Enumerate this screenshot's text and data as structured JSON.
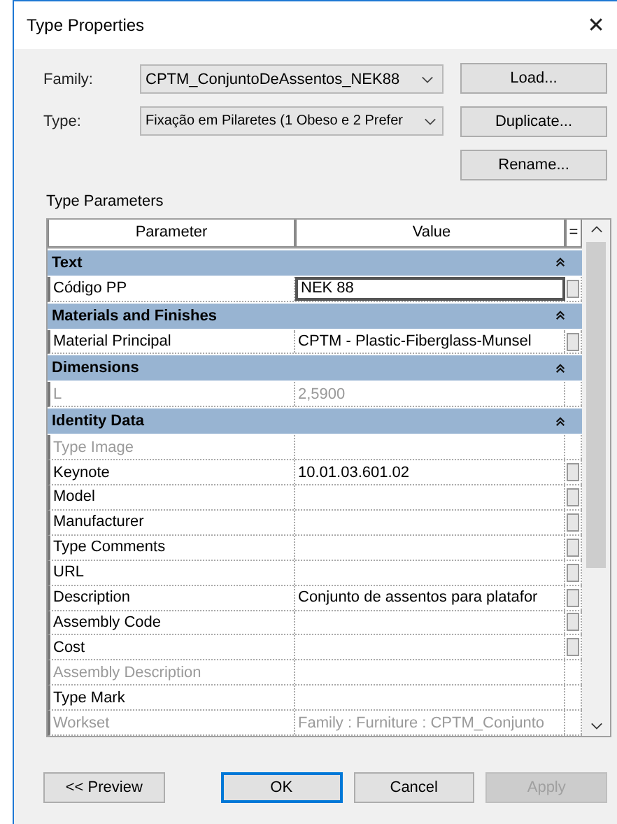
{
  "window": {
    "title": "Type Properties",
    "close": "✕"
  },
  "family": {
    "label": "Family:",
    "value": "CPTM_ConjuntoDeAssentos_NEK88"
  },
  "type": {
    "label": "Type:",
    "value": "Fixação em Pilaretes (1 Obeso e 2 Prefer"
  },
  "side_buttons": [
    "Load...",
    "Duplicate...",
    "Rename..."
  ],
  "section_title": "Type Parameters",
  "table": {
    "columns": [
      "Parameter",
      "Value",
      "="
    ],
    "rows": [
      {
        "kind": "group",
        "name": "Text",
        "expanded": true
      },
      {
        "kind": "param",
        "name": "Código PP",
        "value": "NEK 88",
        "disabled": false,
        "button": true,
        "editing": true
      },
      {
        "kind": "group",
        "name": "Materials and Finishes",
        "expanded": true
      },
      {
        "kind": "param",
        "name": "Material Principal",
        "value": "CPTM - Plastic-Fiberglass-Munsel",
        "disabled": false,
        "button": true,
        "editing": false
      },
      {
        "kind": "group",
        "name": "Dimensions",
        "expanded": true
      },
      {
        "kind": "param",
        "name": "L",
        "value": "2,5900",
        "disabled": true,
        "button": false,
        "editing": false
      },
      {
        "kind": "group",
        "name": "Identity Data",
        "expanded": true
      },
      {
        "kind": "param",
        "name": "Type Image",
        "disabled": true,
        "button": false,
        "editing": false
      },
      {
        "kind": "param",
        "name": "Keynote",
        "value": "10.01.03.601.02",
        "disabled": false,
        "button": true,
        "editing": false
      },
      {
        "kind": "param",
        "name": "Model",
        "disabled": false,
        "button": true,
        "editing": false
      },
      {
        "kind": "param",
        "name": "Manufacturer",
        "disabled": false,
        "button": true,
        "editing": false
      },
      {
        "kind": "param",
        "name": "Type Comments",
        "disabled": false,
        "button": true,
        "editing": false
      },
      {
        "kind": "param",
        "name": "URL",
        "disabled": false,
        "button": true,
        "editing": false
      },
      {
        "kind": "param",
        "name": "Description",
        "value": "Conjunto de assentos para platafor",
        "disabled": false,
        "button": true,
        "editing": false
      },
      {
        "kind": "param",
        "name": "Assembly Code",
        "disabled": false,
        "button": true,
        "editing": false
      },
      {
        "kind": "param",
        "name": "Cost",
        "disabled": false,
        "button": true,
        "editing": false
      },
      {
        "kind": "param",
        "name": "Assembly Description",
        "disabled": true,
        "button": false,
        "editing": false
      },
      {
        "kind": "param",
        "name": "Type Mark",
        "disabled": false,
        "button": false,
        "editing": false
      },
      {
        "kind": "param",
        "name": "Workset",
        "value": "Family : Furniture : CPTM_Conjunto",
        "disabled": true,
        "button": false,
        "editing": false
      }
    ]
  },
  "footer_buttons": [
    {
      "label": "<< Preview",
      "default": false,
      "disabled": false
    },
    {
      "label": "OK",
      "default": true,
      "disabled": false
    },
    {
      "label": "Cancel",
      "default": false,
      "disabled": false
    },
    {
      "label": "Apply",
      "default": false,
      "disabled": true
    }
  ]
}
